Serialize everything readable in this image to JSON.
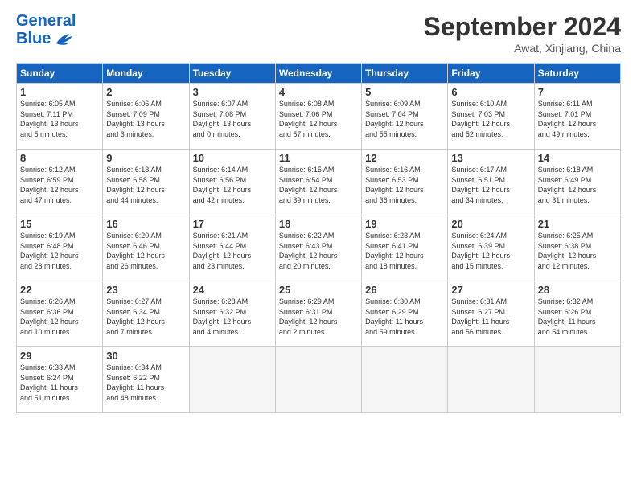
{
  "header": {
    "logo_line1": "General",
    "logo_line2": "Blue",
    "month": "September 2024",
    "location": "Awat, Xinjiang, China"
  },
  "weekdays": [
    "Sunday",
    "Monday",
    "Tuesday",
    "Wednesday",
    "Thursday",
    "Friday",
    "Saturday"
  ],
  "weeks": [
    [
      {
        "day": "1",
        "info": "Sunrise: 6:05 AM\nSunset: 7:11 PM\nDaylight: 13 hours\nand 5 minutes."
      },
      {
        "day": "2",
        "info": "Sunrise: 6:06 AM\nSunset: 7:09 PM\nDaylight: 13 hours\nand 3 minutes."
      },
      {
        "day": "3",
        "info": "Sunrise: 6:07 AM\nSunset: 7:08 PM\nDaylight: 13 hours\nand 0 minutes."
      },
      {
        "day": "4",
        "info": "Sunrise: 6:08 AM\nSunset: 7:06 PM\nDaylight: 12 hours\nand 57 minutes."
      },
      {
        "day": "5",
        "info": "Sunrise: 6:09 AM\nSunset: 7:04 PM\nDaylight: 12 hours\nand 55 minutes."
      },
      {
        "day": "6",
        "info": "Sunrise: 6:10 AM\nSunset: 7:03 PM\nDaylight: 12 hours\nand 52 minutes."
      },
      {
        "day": "7",
        "info": "Sunrise: 6:11 AM\nSunset: 7:01 PM\nDaylight: 12 hours\nand 49 minutes."
      }
    ],
    [
      {
        "day": "8",
        "info": "Sunrise: 6:12 AM\nSunset: 6:59 PM\nDaylight: 12 hours\nand 47 minutes."
      },
      {
        "day": "9",
        "info": "Sunrise: 6:13 AM\nSunset: 6:58 PM\nDaylight: 12 hours\nand 44 minutes."
      },
      {
        "day": "10",
        "info": "Sunrise: 6:14 AM\nSunset: 6:56 PM\nDaylight: 12 hours\nand 42 minutes."
      },
      {
        "day": "11",
        "info": "Sunrise: 6:15 AM\nSunset: 6:54 PM\nDaylight: 12 hours\nand 39 minutes."
      },
      {
        "day": "12",
        "info": "Sunrise: 6:16 AM\nSunset: 6:53 PM\nDaylight: 12 hours\nand 36 minutes."
      },
      {
        "day": "13",
        "info": "Sunrise: 6:17 AM\nSunset: 6:51 PM\nDaylight: 12 hours\nand 34 minutes."
      },
      {
        "day": "14",
        "info": "Sunrise: 6:18 AM\nSunset: 6:49 PM\nDaylight: 12 hours\nand 31 minutes."
      }
    ],
    [
      {
        "day": "15",
        "info": "Sunrise: 6:19 AM\nSunset: 6:48 PM\nDaylight: 12 hours\nand 28 minutes."
      },
      {
        "day": "16",
        "info": "Sunrise: 6:20 AM\nSunset: 6:46 PM\nDaylight: 12 hours\nand 26 minutes."
      },
      {
        "day": "17",
        "info": "Sunrise: 6:21 AM\nSunset: 6:44 PM\nDaylight: 12 hours\nand 23 minutes."
      },
      {
        "day": "18",
        "info": "Sunrise: 6:22 AM\nSunset: 6:43 PM\nDaylight: 12 hours\nand 20 minutes."
      },
      {
        "day": "19",
        "info": "Sunrise: 6:23 AM\nSunset: 6:41 PM\nDaylight: 12 hours\nand 18 minutes."
      },
      {
        "day": "20",
        "info": "Sunrise: 6:24 AM\nSunset: 6:39 PM\nDaylight: 12 hours\nand 15 minutes."
      },
      {
        "day": "21",
        "info": "Sunrise: 6:25 AM\nSunset: 6:38 PM\nDaylight: 12 hours\nand 12 minutes."
      }
    ],
    [
      {
        "day": "22",
        "info": "Sunrise: 6:26 AM\nSunset: 6:36 PM\nDaylight: 12 hours\nand 10 minutes."
      },
      {
        "day": "23",
        "info": "Sunrise: 6:27 AM\nSunset: 6:34 PM\nDaylight: 12 hours\nand 7 minutes."
      },
      {
        "day": "24",
        "info": "Sunrise: 6:28 AM\nSunset: 6:32 PM\nDaylight: 12 hours\nand 4 minutes."
      },
      {
        "day": "25",
        "info": "Sunrise: 6:29 AM\nSunset: 6:31 PM\nDaylight: 12 hours\nand 2 minutes."
      },
      {
        "day": "26",
        "info": "Sunrise: 6:30 AM\nSunset: 6:29 PM\nDaylight: 11 hours\nand 59 minutes."
      },
      {
        "day": "27",
        "info": "Sunrise: 6:31 AM\nSunset: 6:27 PM\nDaylight: 11 hours\nand 56 minutes."
      },
      {
        "day": "28",
        "info": "Sunrise: 6:32 AM\nSunset: 6:26 PM\nDaylight: 11 hours\nand 54 minutes."
      }
    ],
    [
      {
        "day": "29",
        "info": "Sunrise: 6:33 AM\nSunset: 6:24 PM\nDaylight: 11 hours\nand 51 minutes."
      },
      {
        "day": "30",
        "info": "Sunrise: 6:34 AM\nSunset: 6:22 PM\nDaylight: 11 hours\nand 48 minutes."
      },
      {
        "day": "",
        "info": ""
      },
      {
        "day": "",
        "info": ""
      },
      {
        "day": "",
        "info": ""
      },
      {
        "day": "",
        "info": ""
      },
      {
        "day": "",
        "info": ""
      }
    ]
  ]
}
